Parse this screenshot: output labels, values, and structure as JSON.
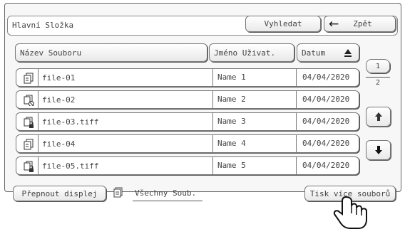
{
  "header": {
    "title": "Hlavní Složka",
    "search_label": "Vyhledat",
    "back_label": "Zpět"
  },
  "columns": {
    "filename": "Název Souboru",
    "username": "Jméno Uživat.",
    "date": "Datum"
  },
  "files": [
    {
      "name": "file-01",
      "user": "Name 1",
      "date": "04/04/2020",
      "icon": "document-icon"
    },
    {
      "name": "file-02",
      "user": "Name 2",
      "date": "04/04/2020",
      "icon": "document-prohibited-icon"
    },
    {
      "name": "file-03.tiff",
      "user": "Name 3",
      "date": "04/04/2020",
      "icon": "document-locked-icon"
    },
    {
      "name": "file-04",
      "user": "Name 4",
      "date": "04/04/2020",
      "icon": "document-icon"
    },
    {
      "name": "file-05.tiff",
      "user": "Name 5",
      "date": "04/04/2020",
      "icon": "document-locked-icon"
    }
  ],
  "pager": {
    "current": "1",
    "total": "2"
  },
  "footer": {
    "switch_display_label": "Přepnout displej",
    "view_mode_label": "Všechny Soub.",
    "print_multiple_label": "Tisk více souborů"
  }
}
